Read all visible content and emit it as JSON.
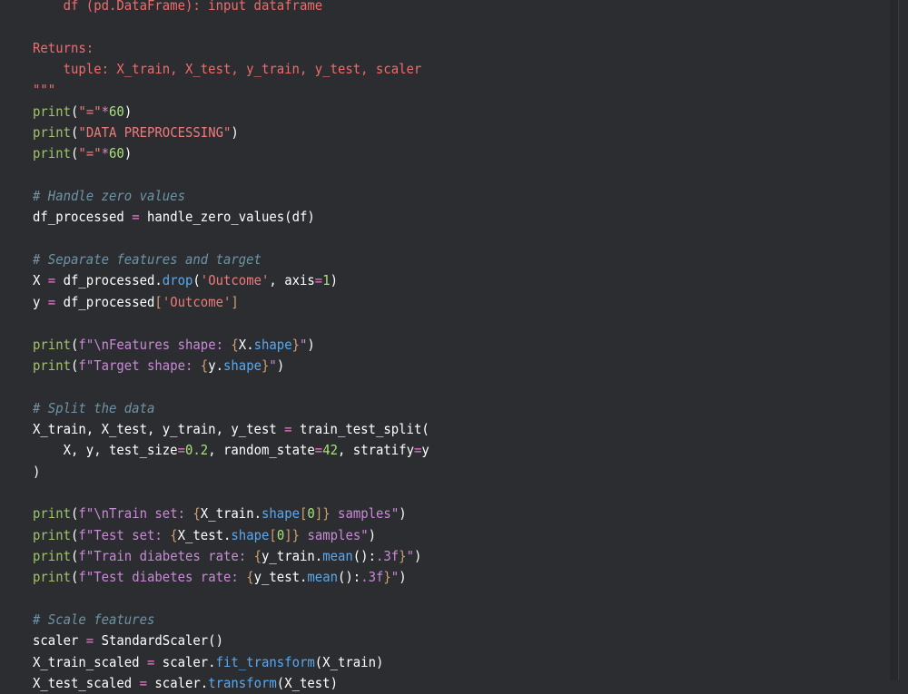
{
  "colors": {
    "background": "#2b2d30",
    "plain": "#ffffff",
    "docstring": "#f06c6c",
    "builtin": "#9fc46a",
    "string": "#f07a7a",
    "fstring": "#c98ad6",
    "number": "#a8e07a",
    "operator": "#f07ad0",
    "method": "#5aa9f0",
    "comment": "#6f94a6",
    "bracket": "#d0a070"
  },
  "code_lines": [
    [
      {
        "t": "    df (pd.DataFrame): input dataframe",
        "c": "docstring"
      }
    ],
    [],
    [
      {
        "t": "Returns:",
        "c": "docstring"
      }
    ],
    [
      {
        "t": "    tuple: X_train, X_test, y_train, y_test, scaler",
        "c": "docstring"
      }
    ],
    [
      {
        "t": "\"\"\"",
        "c": "docstring"
      }
    ],
    [
      {
        "t": "print",
        "c": "builtin"
      },
      {
        "t": "(",
        "c": "plain"
      },
      {
        "t": "\"=\"",
        "c": "string"
      },
      {
        "t": "*",
        "c": "operator"
      },
      {
        "t": "60",
        "c": "number"
      },
      {
        "t": ")",
        "c": "plain"
      }
    ],
    [
      {
        "t": "print",
        "c": "builtin"
      },
      {
        "t": "(",
        "c": "plain"
      },
      {
        "t": "\"DATA PREPROCESSING\"",
        "c": "string"
      },
      {
        "t": ")",
        "c": "plain"
      }
    ],
    [
      {
        "t": "print",
        "c": "builtin"
      },
      {
        "t": "(",
        "c": "plain"
      },
      {
        "t": "\"=\"",
        "c": "string"
      },
      {
        "t": "*",
        "c": "operator"
      },
      {
        "t": "60",
        "c": "number"
      },
      {
        "t": ")",
        "c": "plain"
      }
    ],
    [],
    [
      {
        "t": "# Handle zero values",
        "c": "comment"
      }
    ],
    [
      {
        "t": "df_processed ",
        "c": "plain"
      },
      {
        "t": "=",
        "c": "operator"
      },
      {
        "t": " handle_zero_values(df)",
        "c": "plain"
      }
    ],
    [],
    [
      {
        "t": "# Separate features and target",
        "c": "comment"
      }
    ],
    [
      {
        "t": "X ",
        "c": "plain"
      },
      {
        "t": "=",
        "c": "operator"
      },
      {
        "t": " df_processed.",
        "c": "plain"
      },
      {
        "t": "drop",
        "c": "method"
      },
      {
        "t": "(",
        "c": "plain"
      },
      {
        "t": "'Outcome'",
        "c": "string"
      },
      {
        "t": ", axis",
        "c": "plain"
      },
      {
        "t": "=",
        "c": "operator"
      },
      {
        "t": "1",
        "c": "number"
      },
      {
        "t": ")",
        "c": "plain"
      }
    ],
    [
      {
        "t": "y ",
        "c": "plain"
      },
      {
        "t": "=",
        "c": "operator"
      },
      {
        "t": " df_processed",
        "c": "plain"
      },
      {
        "t": "[",
        "c": "bracket"
      },
      {
        "t": "'Outcome'",
        "c": "string"
      },
      {
        "t": "]",
        "c": "bracket"
      }
    ],
    [],
    [
      {
        "t": "print",
        "c": "builtin"
      },
      {
        "t": "(",
        "c": "plain"
      },
      {
        "t": "f\"\\nFeatures shape: ",
        "c": "fstring"
      },
      {
        "t": "{",
        "c": "bracket"
      },
      {
        "t": "X.",
        "c": "plain"
      },
      {
        "t": "shape",
        "c": "method"
      },
      {
        "t": "}",
        "c": "bracket"
      },
      {
        "t": "\"",
        "c": "fstring"
      },
      {
        "t": ")",
        "c": "plain"
      }
    ],
    [
      {
        "t": "print",
        "c": "builtin"
      },
      {
        "t": "(",
        "c": "plain"
      },
      {
        "t": "f\"Target shape: ",
        "c": "fstring"
      },
      {
        "t": "{",
        "c": "bracket"
      },
      {
        "t": "y.",
        "c": "plain"
      },
      {
        "t": "shape",
        "c": "method"
      },
      {
        "t": "}",
        "c": "bracket"
      },
      {
        "t": "\"",
        "c": "fstring"
      },
      {
        "t": ")",
        "c": "plain"
      }
    ],
    [],
    [
      {
        "t": "# Split the data",
        "c": "comment"
      }
    ],
    [
      {
        "t": "X_train, X_test, y_train, y_test ",
        "c": "plain"
      },
      {
        "t": "=",
        "c": "operator"
      },
      {
        "t": " train_test_split(",
        "c": "plain"
      }
    ],
    [
      {
        "t": "    X, y, test_size",
        "c": "plain"
      },
      {
        "t": "=",
        "c": "operator"
      },
      {
        "t": "0.2",
        "c": "number"
      },
      {
        "t": ", random_state",
        "c": "plain"
      },
      {
        "t": "=",
        "c": "operator"
      },
      {
        "t": "42",
        "c": "number"
      },
      {
        "t": ", stratify",
        "c": "plain"
      },
      {
        "t": "=",
        "c": "operator"
      },
      {
        "t": "y",
        "c": "plain"
      }
    ],
    [
      {
        "t": ")",
        "c": "plain"
      }
    ],
    [],
    [
      {
        "t": "print",
        "c": "builtin"
      },
      {
        "t": "(",
        "c": "plain"
      },
      {
        "t": "f\"\\nTrain set: ",
        "c": "fstring"
      },
      {
        "t": "{",
        "c": "bracket"
      },
      {
        "t": "X_train.",
        "c": "plain"
      },
      {
        "t": "shape",
        "c": "method"
      },
      {
        "t": "[",
        "c": "bracket"
      },
      {
        "t": "0",
        "c": "number"
      },
      {
        "t": "]",
        "c": "bracket"
      },
      {
        "t": "}",
        "c": "bracket"
      },
      {
        "t": " samples\"",
        "c": "fstring"
      },
      {
        "t": ")",
        "c": "plain"
      }
    ],
    [
      {
        "t": "print",
        "c": "builtin"
      },
      {
        "t": "(",
        "c": "plain"
      },
      {
        "t": "f\"Test set: ",
        "c": "fstring"
      },
      {
        "t": "{",
        "c": "bracket"
      },
      {
        "t": "X_test.",
        "c": "plain"
      },
      {
        "t": "shape",
        "c": "method"
      },
      {
        "t": "[",
        "c": "bracket"
      },
      {
        "t": "0",
        "c": "number"
      },
      {
        "t": "]",
        "c": "bracket"
      },
      {
        "t": "}",
        "c": "bracket"
      },
      {
        "t": " samples\"",
        "c": "fstring"
      },
      {
        "t": ")",
        "c": "plain"
      }
    ],
    [
      {
        "t": "print",
        "c": "builtin"
      },
      {
        "t": "(",
        "c": "plain"
      },
      {
        "t": "f\"Train diabetes rate: ",
        "c": "fstring"
      },
      {
        "t": "{",
        "c": "bracket"
      },
      {
        "t": "y_train.",
        "c": "plain"
      },
      {
        "t": "mean",
        "c": "method"
      },
      {
        "t": "():",
        "c": "plain"
      },
      {
        "t": ".3f",
        "c": "fstring"
      },
      {
        "t": "}",
        "c": "bracket"
      },
      {
        "t": "\"",
        "c": "fstring"
      },
      {
        "t": ")",
        "c": "plain"
      }
    ],
    [
      {
        "t": "print",
        "c": "builtin"
      },
      {
        "t": "(",
        "c": "plain"
      },
      {
        "t": "f\"Test diabetes rate: ",
        "c": "fstring"
      },
      {
        "t": "{",
        "c": "bracket"
      },
      {
        "t": "y_test.",
        "c": "plain"
      },
      {
        "t": "mean",
        "c": "method"
      },
      {
        "t": "():",
        "c": "plain"
      },
      {
        "t": ".3f",
        "c": "fstring"
      },
      {
        "t": "}",
        "c": "bracket"
      },
      {
        "t": "\"",
        "c": "fstring"
      },
      {
        "t": ")",
        "c": "plain"
      }
    ],
    [],
    [
      {
        "t": "# Scale features",
        "c": "comment"
      }
    ],
    [
      {
        "t": "scaler ",
        "c": "plain"
      },
      {
        "t": "=",
        "c": "operator"
      },
      {
        "t": " StandardScaler()",
        "c": "plain"
      }
    ],
    [
      {
        "t": "X_train_scaled ",
        "c": "plain"
      },
      {
        "t": "=",
        "c": "operator"
      },
      {
        "t": " scaler.",
        "c": "plain"
      },
      {
        "t": "fit_transform",
        "c": "method"
      },
      {
        "t": "(X_train)",
        "c": "plain"
      }
    ],
    [
      {
        "t": "X_test_scaled ",
        "c": "plain"
      },
      {
        "t": "=",
        "c": "operator"
      },
      {
        "t": " scaler.",
        "c": "plain"
      },
      {
        "t": "transform",
        "c": "method"
      },
      {
        "t": "(X_test)",
        "c": "plain"
      }
    ]
  ]
}
